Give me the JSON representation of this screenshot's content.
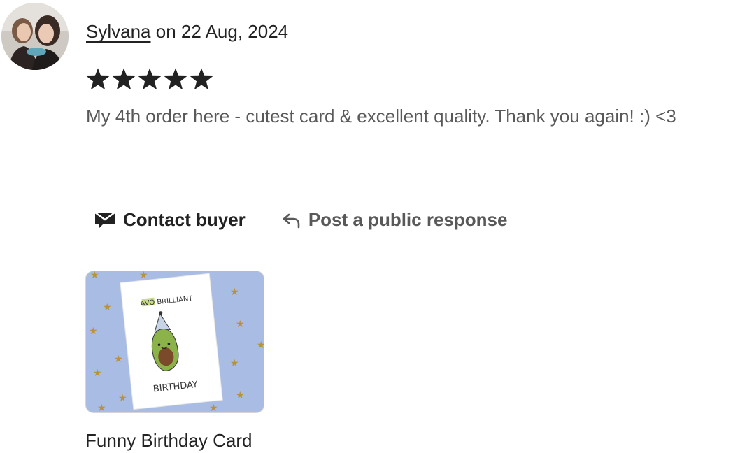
{
  "review": {
    "reviewer_name": "Sylvana",
    "date_text": "on 22 Aug, 2024",
    "rating": 5,
    "rating_max": 5,
    "star_color": "#222222",
    "body": "My 4th order here - cutest card & excellent quality. Thank you again! :) <3"
  },
  "actions": {
    "contact_label": "Contact buyer",
    "contact_icon": "envelope-icon",
    "respond_label": "Post a public response",
    "respond_icon": "reply-arrow-icon"
  },
  "product": {
    "title": "Funny Birthday Card",
    "card_text_top": "AVO BRILLIANT",
    "card_text_bottom": "BIRTHDAY"
  }
}
